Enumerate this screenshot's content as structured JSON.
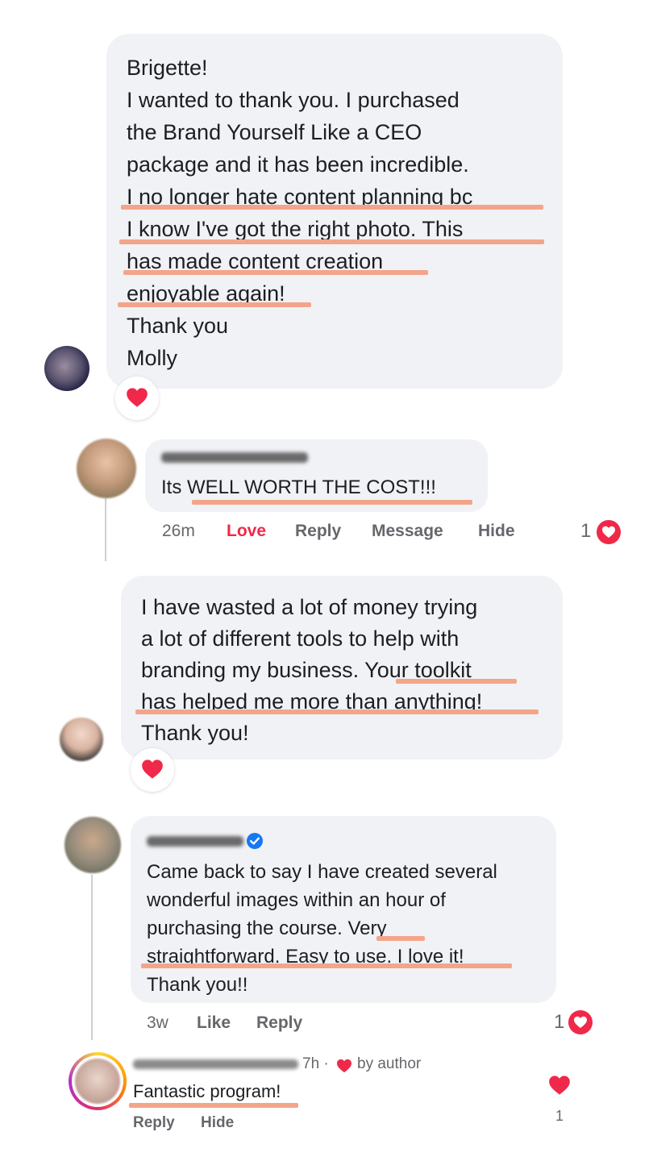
{
  "comment1": {
    "lines": [
      "Brigette!",
      "I wanted to thank you. I purchased",
      "the Brand Yourself Like a CEO",
      "package and it has been incredible.",
      "I no longer hate content planning bc",
      "I know I've got the right photo. This",
      "has made content creation",
      "enjoyable again!",
      "Thank you",
      "Molly"
    ],
    "reaction_icon": "heart-icon"
  },
  "reply1": {
    "text_prefix": "Its ",
    "text_highlight": "WELL WORTH THE COST!!!",
    "timestamp": "26m",
    "love_label": "Love",
    "reply_label": "Reply",
    "message_label": "Message",
    "hide_label": "Hide",
    "reaction_count": "1"
  },
  "comment2": {
    "lines": [
      "I have wasted a lot of money trying",
      "a lot of different tools to help with",
      "branding my business. Your toolkit",
      "has helped me more than anything!",
      "Thank you!"
    ],
    "reaction_icon": "heart-icon"
  },
  "reply2": {
    "lines": [
      "Came back to say I have created several",
      "wonderful images within an hour of",
      "purchasing the course. Very",
      "straightforward. Easy to use. I love it!",
      "Thank you!!"
    ],
    "timestamp": "3w",
    "like_label": "Like",
    "reply_label": "Reply",
    "reaction_count": "1"
  },
  "comment3": {
    "meta_time": "7h ·",
    "meta_author": "by author",
    "text": "Fantastic program!",
    "reply_label": "Reply",
    "hide_label": "Hide",
    "like_count": "1"
  },
  "colors": {
    "bubble": "#f0f2f5",
    "highlight": "#f3a58a",
    "love": "#f02849",
    "secondary_text": "#65676b",
    "verified": "#1877f2"
  }
}
